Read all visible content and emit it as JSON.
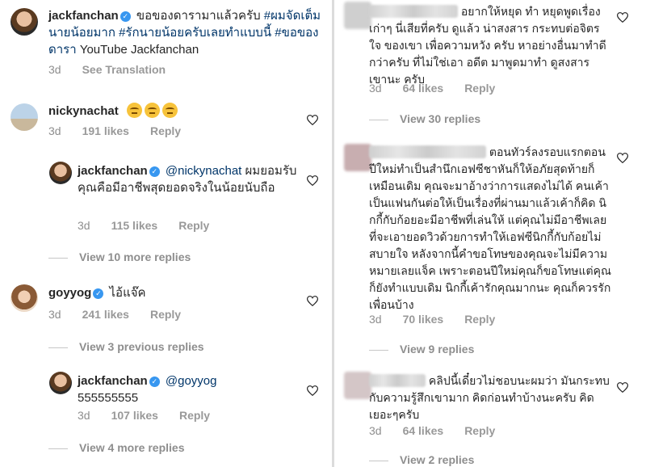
{
  "left_column": {
    "comment1": {
      "username": "jackfanchan",
      "text": "ขอของดารามาแล้วครับ",
      "hashtags": "#ผมจัดเต็มนายน้อยมาก #รักนายน้อยครับเลยทำแบบนี้ #ขอของดารา",
      "tail": "YouTube Jackfanchan",
      "time": "3d",
      "translate": "See Translation"
    },
    "comment2": {
      "username": "nickynachat",
      "time": "3d",
      "likes": "191 likes",
      "reply": "Reply",
      "reply_item": {
        "username": "jackfanchan",
        "mention": "@nickynachat",
        "text": "ผมยอมรับคุณคือมีอาชีพสุดยอดจริงในน้อยนับถือ",
        "time": "3d",
        "likes": "115 likes",
        "reply": "Reply"
      },
      "view_more": "View 10 more replies"
    },
    "comment3": {
      "username": "goyyog",
      "text": "ไอ้แจ๊ค",
      "time": "3d",
      "likes": "241 likes",
      "reply": "Reply",
      "view_previous": "View 3 previous replies",
      "reply_item": {
        "username": "jackfanchan",
        "mention": "@goyyog",
        "text": "555555555",
        "time": "3d",
        "likes": "107 likes",
        "reply": "Reply"
      },
      "view_more": "View 4 more replies"
    }
  },
  "right_column": {
    "comment1": {
      "text": "อยากให้หยุด ทำ หยุดพูดเรื่องเก่าๆ นี่เสียที่ครับ ดูแล้ว น่าสงสาร กระทบต่อจิตรใจ ของเขา เพื่อความหวัง ครับ หาอย่างอื่นมาทำดี กว่าครับ ที่ไม่ใช่เอา อดีต มาพูดมาทำ ดูสงสารเขานะ ครับ",
      "time": "3d",
      "likes": "64 likes",
      "reply": "Reply",
      "view_replies": "View 30 replies"
    },
    "comment2": {
      "text": "ตอนทัวร์ลงรอบแรกตอนปีใหม่ทำเป็นสำนึกเอฟซีชาหันก็ให้อภัยสุดท้ายก็เหมือนเดิม คุณจะมาอ้างว่าการแสดงไม่ได้ คนเค้าเป็นแฟนกันต่อให้เป็นเรื่องที่ผ่านมาแล้วเค้าก็คิด นิกกี้กับก้อยอะมีอาชีพที่เล่นให้ แต่คุณไม่มีอาชีพเลยที่จะเอายอดวิวด้วยการทำให้เอฟซีนิกกี้กับก้อยไม่สบายใจ หลังจากนี้คำขอโทษของคุณจะไม่มีความหมายเลยแจ็ค เพราะตอนปีใหม่คุณก็ขอโทษแต่คุณก็ยังทำแบบเดิม นิกกี้เค้ารักคุณมากนะ คุณก็ควรรักเพื่อนบ้าง",
      "time": "3d",
      "likes": "70 likes",
      "reply": "Reply",
      "view_replies": "View 9 replies"
    },
    "comment3": {
      "text": "คลิปนี้เดี๋ยวไม่ชอบนะผมว่า มันกระทบกับความรู้สึกเขามาก คิดก่อนทำบ้างนะครับ คิดเยอะๆครับ",
      "time": "3d",
      "likes": "64 likes",
      "reply": "Reply",
      "view_replies": "View 2 replies"
    }
  },
  "colors": {
    "text": "#262626",
    "meta": "#8e8e8e",
    "link": "#003569",
    "verified": "#3897f0"
  }
}
